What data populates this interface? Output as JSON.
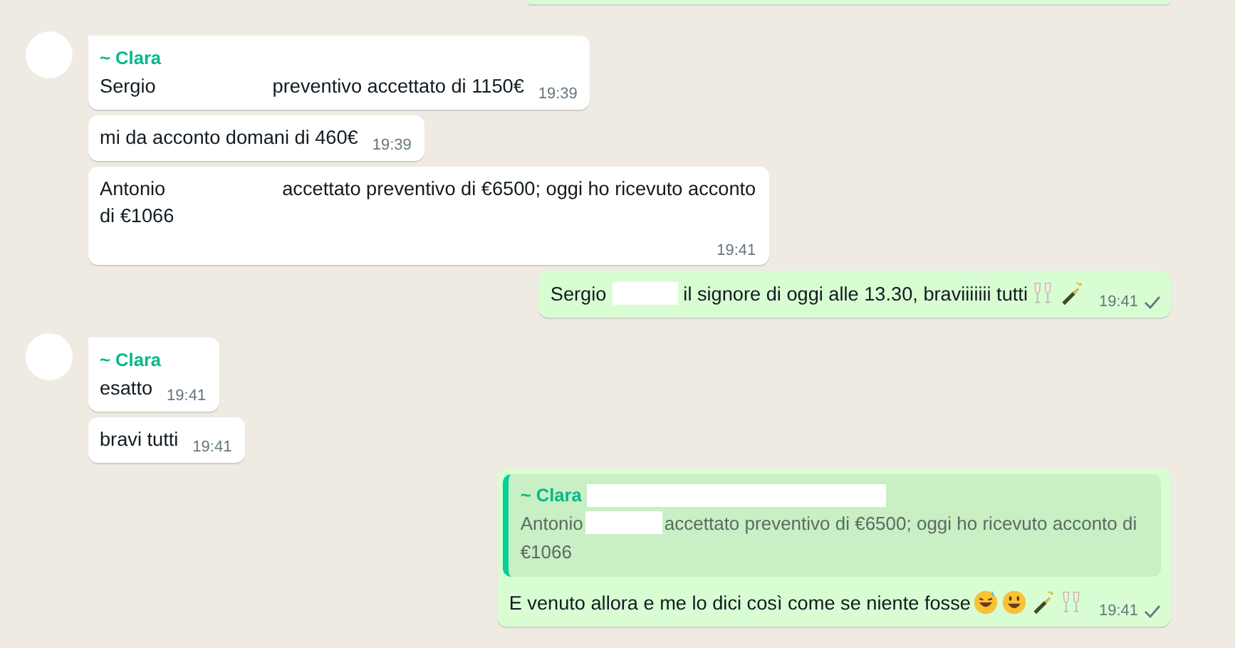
{
  "messages": [
    {
      "kind": "outgoing_cut"
    },
    {
      "kind": "incoming",
      "avatar": true,
      "sender": "~ Clara",
      "segments": [
        {
          "kind": "text",
          "text": "Sergio"
        },
        {
          "kind": "blank"
        },
        {
          "kind": "text",
          "text": "preventivo accettato di 1150€"
        }
      ],
      "time": "19:39"
    },
    {
      "kind": "incoming",
      "avatar": false,
      "segments": [
        {
          "kind": "text",
          "text": "mi da acconto domani di 460€"
        }
      ],
      "time": "19:39"
    },
    {
      "kind": "incoming",
      "avatar": false,
      "segments": [
        {
          "kind": "text",
          "text": "Antonio"
        },
        {
          "kind": "blank"
        },
        {
          "kind": "text",
          "text": "accettato preventivo di €6500; oggi ho ricevuto acconto"
        },
        {
          "kind": "line",
          "text": "di €1066"
        }
      ],
      "time": "19:41"
    },
    {
      "kind": "outgoing",
      "segments": [
        {
          "kind": "text",
          "text": "Sergio"
        },
        {
          "kind": "redacted"
        },
        {
          "kind": "text",
          "text": "il signore di oggi alle 13.30, braviiiiiii tutti"
        },
        {
          "kind": "glasses"
        },
        {
          "kind": "bottle"
        }
      ],
      "time": "19:41",
      "sent": true
    },
    {
      "kind": "incoming",
      "avatar": true,
      "sender": "~ Clara",
      "segments": [
        {
          "kind": "text",
          "text": "esatto"
        }
      ],
      "time": "19:41"
    },
    {
      "kind": "incoming",
      "avatar": false,
      "segments": [
        {
          "kind": "text",
          "text": "bravi tutti"
        }
      ],
      "time": "19:41"
    },
    {
      "kind": "outgoing",
      "quote": {
        "sender": "~ Clara",
        "sender_redacted": true,
        "segments": [
          {
            "kind": "text",
            "text": "Antonio"
          },
          {
            "kind": "redacted"
          },
          {
            "kind": "text",
            "text": "accettato preventivo di €6500; oggi ho ricevuto acconto di"
          },
          {
            "kind": "line",
            "text": "€1066"
          }
        ]
      },
      "segments": [
        {
          "kind": "text",
          "text": "E venuto allora e me lo dici così come se niente fosse"
        },
        {
          "kind": "sweat-grin"
        },
        {
          "kind": "grin"
        },
        {
          "kind": "bottle"
        },
        {
          "kind": "glasses"
        }
      ],
      "time": "19:41",
      "sent": true
    }
  ]
}
